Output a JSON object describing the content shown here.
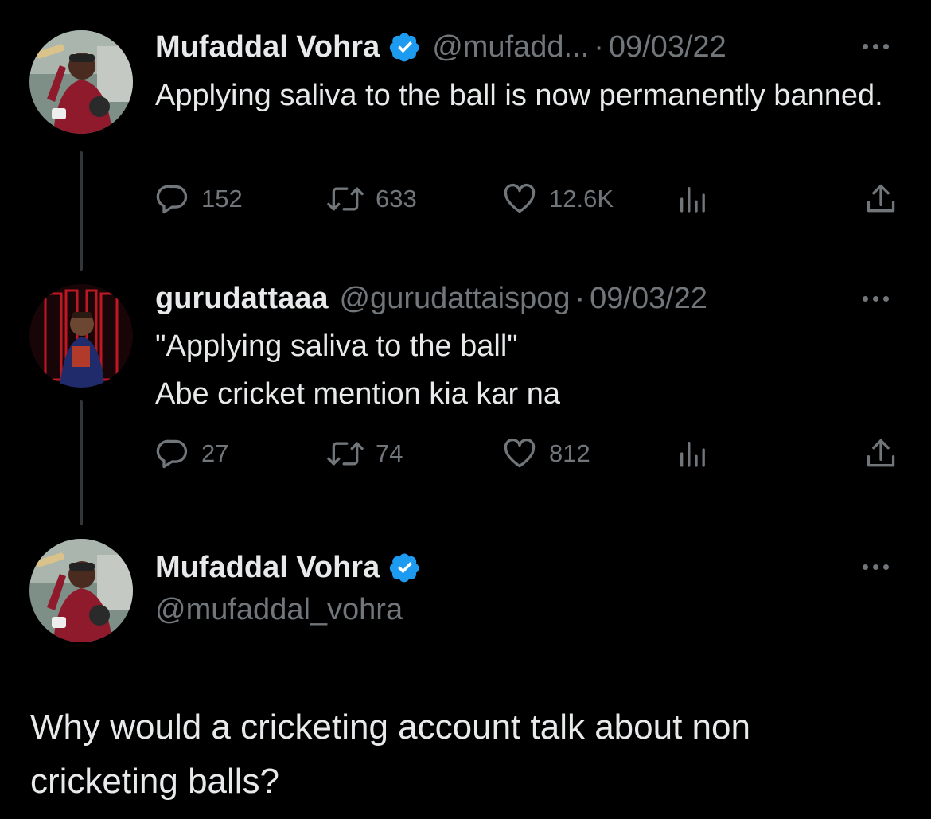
{
  "colors": {
    "background": "#000000",
    "text_primary": "#e7e9ea",
    "text_secondary": "#71767b",
    "verified_badge": "#1d9bf0",
    "thread_line": "#333639"
  },
  "thread": [
    {
      "author": {
        "name": "Mufaddal Vohra",
        "handle": "@mufadd...",
        "verified": true,
        "avatar_icon": "avatar-cricketer-celebrating"
      },
      "separator": "·",
      "date": "09/03/22",
      "text": "Applying saliva to the ball is now permanently banned.",
      "stats": {
        "replies": "152",
        "reposts": "633",
        "likes": "12.6K"
      }
    },
    {
      "author": {
        "name": "gurudattaaa",
        "handle": "@gurudattaispog",
        "verified": false,
        "avatar_icon": "avatar-player-red-background"
      },
      "separator": "·",
      "date": "09/03/22",
      "text_lines": [
        "\"Applying saliva to the ball\"",
        "Abe cricket mention kia kar na"
      ],
      "stats": {
        "replies": "27",
        "reposts": "74",
        "likes": "812"
      }
    }
  ],
  "main_tweet": {
    "author": {
      "name": "Mufaddal Vohra",
      "handle": "@mufaddal_vohra",
      "verified": true,
      "avatar_icon": "avatar-cricketer-celebrating"
    },
    "text": "Why would a cricketing account talk about non cricketing balls?"
  },
  "icons": {
    "reply": "reply-icon",
    "repost": "repost-icon",
    "like": "heart-icon",
    "views": "analytics-icon",
    "share": "share-icon",
    "more": "more-options-icon",
    "verified": "verified-badge-icon"
  }
}
